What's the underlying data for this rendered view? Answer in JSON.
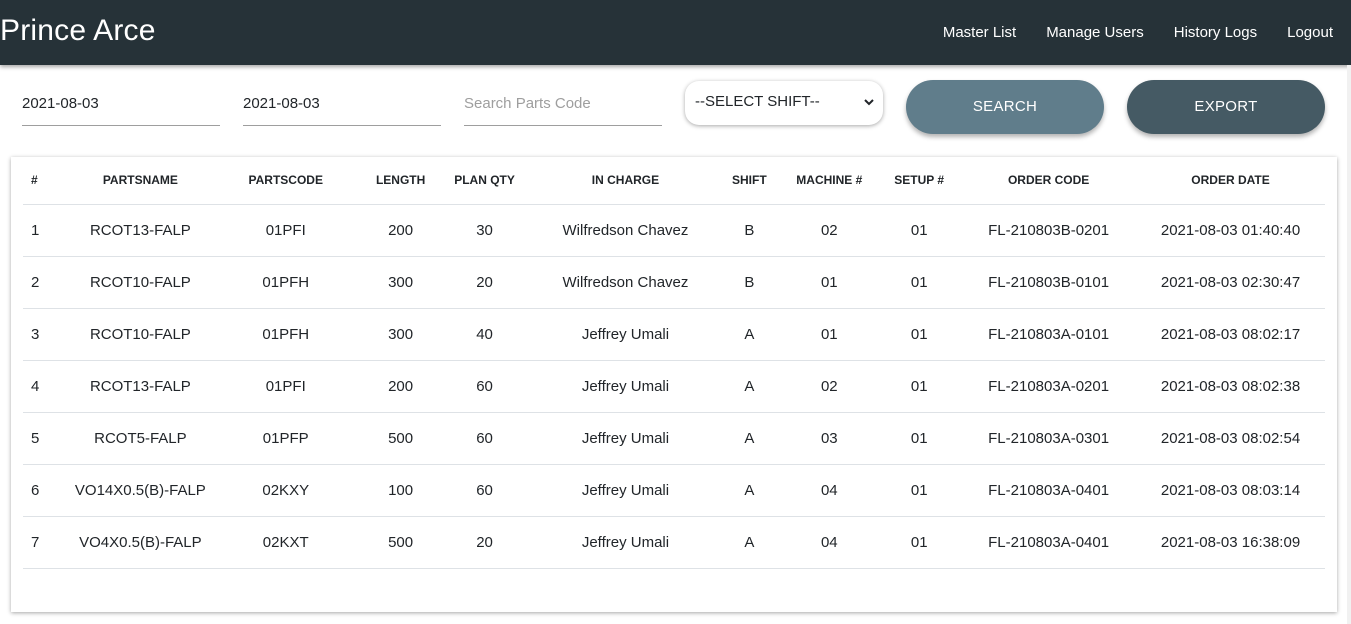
{
  "navbar": {
    "brand": "Prince Arce",
    "links": [
      "Master List",
      "Manage Users",
      "History Logs",
      "Logout"
    ]
  },
  "filters": {
    "date_from": "2021-08-03",
    "date_to": "2021-08-03",
    "parts_code_placeholder": "Search Parts Code",
    "shift_selected": "--SELECT SHIFT--",
    "search_label": "SEARCH",
    "export_label": "EXPORT"
  },
  "table": {
    "headers": [
      "#",
      "PARTSNAME",
      "PARTSCODE",
      "LENGTH",
      "PLAN QTY",
      "IN CHARGE",
      "SHIFT",
      "MACHINE #",
      "SETUP #",
      "ORDER CODE",
      "ORDER DATE"
    ],
    "rows": [
      [
        "1",
        "RCOT13-FALP",
        "01PFI",
        "200",
        "30",
        "Wilfredson Chavez",
        "B",
        "02",
        "01",
        "FL-210803B-0201",
        "2021-08-03 01:40:40"
      ],
      [
        "2",
        "RCOT10-FALP",
        "01PFH",
        "300",
        "20",
        "Wilfredson Chavez",
        "B",
        "01",
        "01",
        "FL-210803B-0101",
        "2021-08-03 02:30:47"
      ],
      [
        "3",
        "RCOT10-FALP",
        "01PFH",
        "300",
        "40",
        "Jeffrey Umali",
        "A",
        "01",
        "01",
        "FL-210803A-0101",
        "2021-08-03 08:02:17"
      ],
      [
        "4",
        "RCOT13-FALP",
        "01PFI",
        "200",
        "60",
        "Jeffrey Umali",
        "A",
        "02",
        "01",
        "FL-210803A-0201",
        "2021-08-03 08:02:38"
      ],
      [
        "5",
        "RCOT5-FALP",
        "01PFP",
        "500",
        "60",
        "Jeffrey Umali",
        "A",
        "03",
        "01",
        "FL-210803A-0301",
        "2021-08-03 08:02:54"
      ],
      [
        "6",
        "VO14X0.5(B)-FALP",
        "02KXY",
        "100",
        "60",
        "Jeffrey Umali",
        "A",
        "04",
        "01",
        "FL-210803A-0401",
        "2021-08-03 08:03:14"
      ],
      [
        "7",
        "VO4X0.5(B)-FALP",
        "02KXT",
        "500",
        "20",
        "Jeffrey Umali",
        "A",
        "04",
        "01",
        "FL-210803A-0401",
        "2021-08-03 16:38:09"
      ]
    ]
  },
  "icons": {
    "select_chevron": "chevron-down-icon"
  }
}
